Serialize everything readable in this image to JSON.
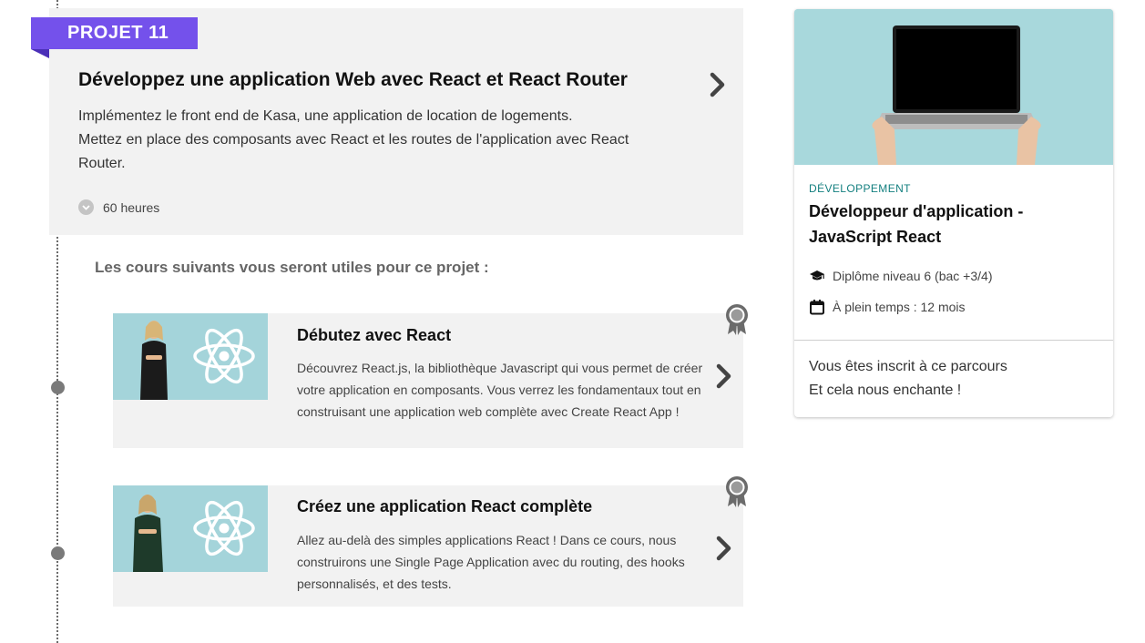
{
  "project": {
    "badge": "PROJET 11",
    "title": "Développez une application Web avec React et React Router",
    "description_lines": [
      "Implémentez le front end de Kasa, une application de location de logements.",
      "Mettez en place des composants avec React et les routes de l'application avec React",
      "Router."
    ],
    "duration": "60 heures"
  },
  "useful_courses_heading": "Les cours suivants vous seront utiles pour ce projet :",
  "courses": [
    {
      "title": "Débutez avec React",
      "description": "Découvrez React.js, la bibliothèque Javascript qui vous permet de créer votre application en composants. Vous verrez les fondamentaux tout en construisant une application web complète avec Create React App !"
    },
    {
      "title": "Créez une application React complète",
      "description": "Allez au-delà des simples applications React ! Dans ce cours, nous construirons une Single Page Application avec du routing, des hooks personnalisés, et des tests."
    }
  ],
  "path_card": {
    "category": "DÉVELOPPEMENT",
    "title": "Développeur d'application - JavaScript React",
    "diploma": "Diplôme niveau 6 (bac +3/4)",
    "schedule": "À plein temps : 12 mois",
    "enrolled_lines": [
      "Vous êtes inscrit à ce parcours",
      "Et cela nous enchante !"
    ]
  },
  "colors": {
    "accent": "#7451eb",
    "category": "#137f7f",
    "card_bg": "#f2f2f2",
    "thumb_bg": "#a4d4da"
  },
  "icons": [
    "clock-icon",
    "chevron-right-icon",
    "award-ribbon-icon",
    "graduation-cap-icon",
    "calendar-icon",
    "react-logo-icon"
  ]
}
